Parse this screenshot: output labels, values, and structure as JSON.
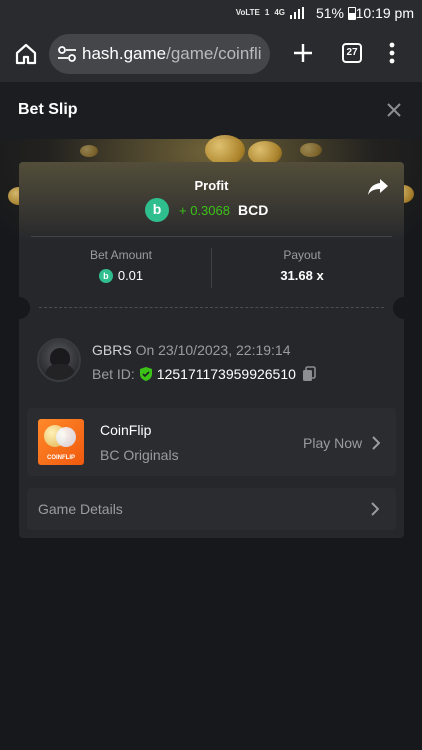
{
  "status_bar": {
    "network_icons": [
      "VoLTE",
      "LTE",
      "1",
      "4G"
    ],
    "battery": "51%",
    "time": "10:19 pm"
  },
  "browser": {
    "url_host": "hash.game",
    "url_path": "/game/coinfli",
    "tab_count": "27",
    "icons": [
      "home-icon",
      "site-settings-icon",
      "new-tab-icon",
      "tab-switcher-icon",
      "more-menu-icon"
    ]
  },
  "header": {
    "title": "Bet Slip"
  },
  "profit": {
    "label": "Profit",
    "value": "+ 0.3068",
    "currency": "BCD",
    "value_color": "#3bc117"
  },
  "bet": {
    "amount_label": "Bet Amount",
    "amount_value": "0.01",
    "payout_label": "Payout",
    "payout_value": "31.68 x"
  },
  "user": {
    "name": "GBRS",
    "timestamp": "On 23/10/2023, 22:19:14",
    "bet_id_label": "Bet ID:",
    "bet_id": "125171173959926510"
  },
  "game": {
    "thumb_label": "COINFLIP",
    "name": "CoinFlip",
    "provider": "BC Originals",
    "play_label": "Play Now"
  },
  "details": {
    "label": "Game Details"
  },
  "colors": {
    "accent_green": "#2fbf8f",
    "background": "#17181b",
    "card": "#26272b"
  }
}
